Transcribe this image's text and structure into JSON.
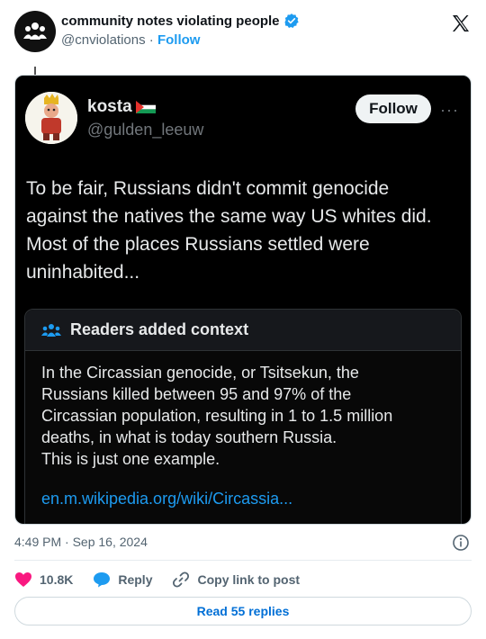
{
  "author": {
    "name": "community notes violating people",
    "handle": "@cnviolations",
    "separator": "·",
    "follow_label": "Follow"
  },
  "quoted": {
    "name": "kosta",
    "handle": "@gulden_leeuw",
    "follow_label": "Follow",
    "more_label": "···",
    "text": "To be fair, Russians didn't commit genocide against the natives the same way US whites did. Most of the places Russians settled were uninhabited...",
    "note": {
      "title": "Readers added context",
      "body_lines": [
        "In the Circassian genocide, or Tsitsekun, the",
        "Russians killed between 95 and 97% of the",
        "Circassian population, resulting in 1 to 1.5 million",
        "deaths, in what is today southern Russia.",
        "This is just one example."
      ],
      "link": "en.m.wikipedia.org/wiki/Circassia..."
    }
  },
  "timestamp": "4:49 PM · Sep 16, 2024",
  "actions": {
    "likes": "10.8K",
    "reply_label": "Reply",
    "copy_label": "Copy link to post"
  },
  "read_replies_label": "Read 55 replies",
  "colors": {
    "accent": "#1d9bf0",
    "like": "#f91880",
    "embed_bg": "#000000"
  }
}
